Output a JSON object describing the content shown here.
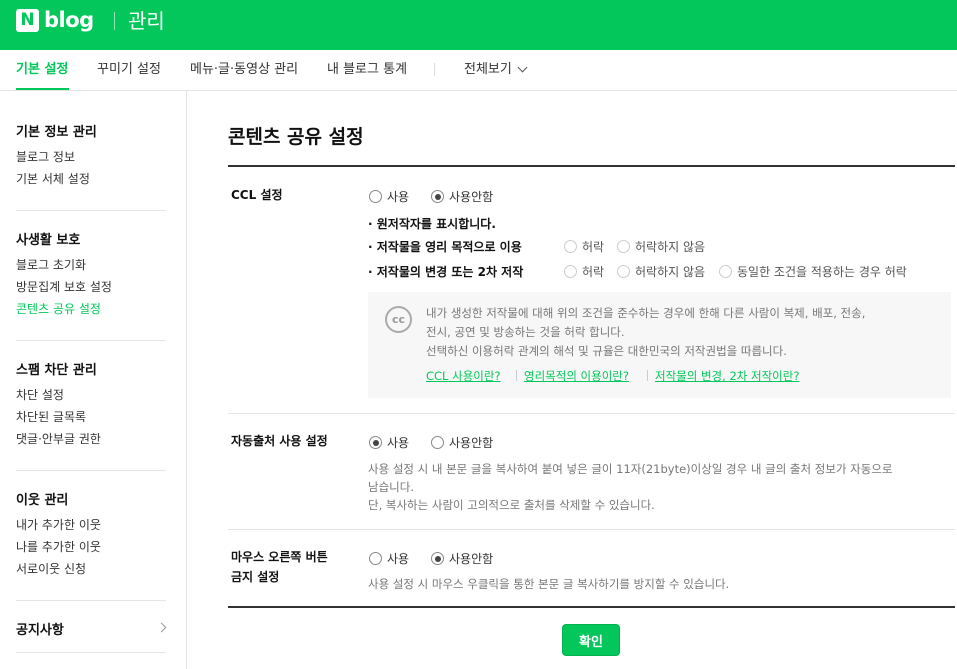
{
  "header": {
    "logo_letter": "N",
    "logo_text": "blog",
    "section_title": "관리"
  },
  "tabs": [
    {
      "label": "기본 설정",
      "active": true
    },
    {
      "label": "꾸미기 설정"
    },
    {
      "label": "메뉴·글·동영상 관리"
    },
    {
      "label": "내 블로그 통계"
    },
    {
      "label": "전체보기"
    }
  ],
  "sidebar": {
    "groups": [
      {
        "title": "기본 정보 관리",
        "items": [
          "블로그 정보",
          "기본 서체 설정"
        ]
      },
      {
        "title": "사생활 보호",
        "items": [
          "블로그 초기화",
          "방문집계 보호 설정",
          "콘텐츠 공유 설정"
        ]
      },
      {
        "title": "스팸 차단 관리",
        "items": [
          "차단 설정",
          "차단된 글목록",
          "댓글·안부글 권한"
        ]
      },
      {
        "title": "이웃 관리",
        "items": [
          "내가 추가한 이웃",
          "나를 추가한 이웃",
          "서로이웃 신청"
        ]
      },
      {
        "title": "공지사항"
      }
    ],
    "active_item": "콘텐츠 공유 설정"
  },
  "content": {
    "title": "콘텐츠 공유 설정",
    "ccl": {
      "label": "CCL 설정",
      "options": [
        "사용",
        "사용안함"
      ],
      "selected": "사용안함",
      "author_line": "· 원저작자를 표시합니다.",
      "commercial": {
        "label": "· 저작물을 영리 목적으로 이용",
        "options": [
          "허락",
          "허락하지 않음"
        ]
      },
      "derivative": {
        "label": "· 저작물의 변경 또는 2차 저작",
        "options": [
          "허락",
          "허락하지 않음",
          "동일한 조건을 적용하는 경우 허락"
        ]
      },
      "info_lines": [
        "내가 생성한 저작물에 대해 위의 조건을 준수하는 경우에 한해 다른 사람이 복제, 배포, 전송,",
        "전시, 공연 및 방송하는 것을 허락 합니다.",
        "선택하신 이용허락 관계의 해석 및 규율은 대한민국의 저작권법을 따릅니다."
      ],
      "cc_icon_text": "cc",
      "links": [
        "CCL 사용이란?",
        "영리목적의 이용이란?",
        "저작물의 변경, 2차 저작이란?"
      ]
    },
    "auto_source": {
      "label": "자동출처 사용 설정",
      "options": [
        "사용",
        "사용안함"
      ],
      "selected": "사용",
      "desc_lines": [
        "사용 설정 시 내 본문 글을 복사하여 붙여 넣은 글이 11자(21byte)이상일 경우 내 글의 출처 정보가 자동으로",
        "남습니다.",
        "단, 복사하는 사람이 고의적으로 출처를 삭제할 수 있습니다."
      ]
    },
    "right_click": {
      "label_lines": [
        "마우스 오른쪽 버튼",
        "금지 설정"
      ],
      "options": [
        "사용",
        "사용안함"
      ],
      "selected": "사용안함",
      "desc": "사용 설정 시 마우스 우클릭을 통한 본문 글 복사하기를 방지할 수 있습니다."
    },
    "confirm_label": "확인"
  },
  "colors": {
    "brand": "#03c75a"
  }
}
